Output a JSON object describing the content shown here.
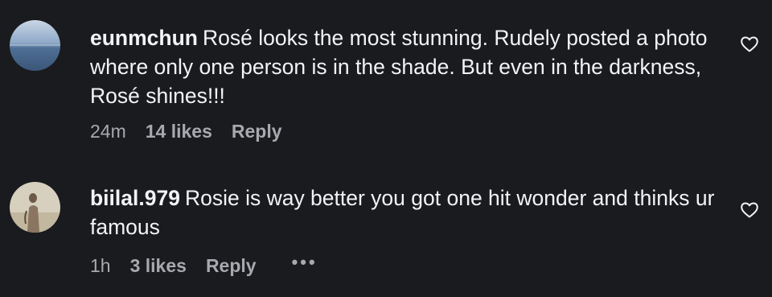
{
  "comments": [
    {
      "username": "eunmchun",
      "text": "Rosé looks the most stunning. Rudely posted a photo where only one person is in the shade. But even in the darkness, Rosé shines!!!",
      "age": "24m",
      "likes": "14 likes",
      "reply": "Reply"
    },
    {
      "username": "biilal.979",
      "text": "Rosie is way better you got one hit wonder and thinks ur famous",
      "age": "1h",
      "likes": "3 likes",
      "reply": "Reply",
      "more": "•••"
    }
  ],
  "icons": {
    "like": "heart-outline-icon",
    "more": "more-dots-icon"
  },
  "colors": {
    "background": "#1a1b1e",
    "text": "#f2f3f5",
    "meta": "#a7a9ae"
  }
}
